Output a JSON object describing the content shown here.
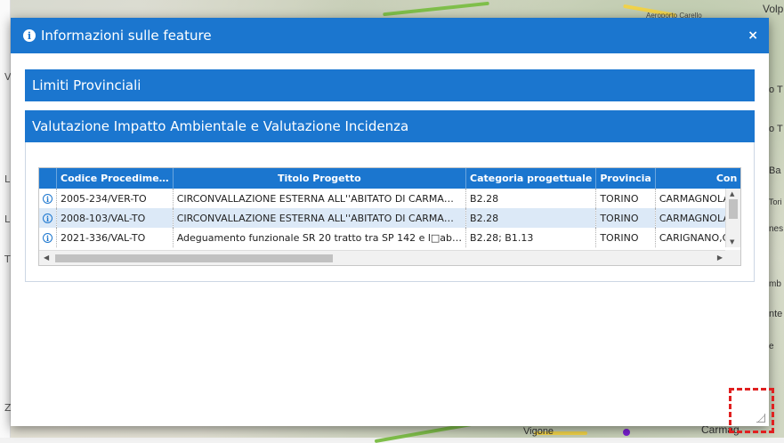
{
  "dialog": {
    "title": "Informazioni sulle feature",
    "close_label": "×"
  },
  "sections": [
    {
      "title": "Limiti Provinciali"
    },
    {
      "title": "Valutazione Impatto Ambientale e Valutazione Incidenza"
    }
  ],
  "table": {
    "columns": [
      "",
      "Codice Procedime…",
      "Titolo Progetto",
      "Categoria progettuale",
      "Provincia",
      "Con"
    ],
    "rows": [
      {
        "icon": "info-icon",
        "codice": "2005-234/VER-TO",
        "titolo": "CIRCONVALLAZIONE ESTERNA ALL''ABITATO DI CARMA…",
        "categoria": "B2.28",
        "provincia": "TORINO",
        "comune": "CARMAGNOLA"
      },
      {
        "icon": "info-icon",
        "codice": "2008-103/VAL-TO",
        "titolo": "CIRCONVALLAZIONE ESTERNA ALL''ABITATO DI CARMA…",
        "categoria": "B2.28",
        "provincia": "TORINO",
        "comune": "CARMAGNOLA"
      },
      {
        "icon": "info-icon",
        "codice": "2021-336/VAL-TO",
        "titolo": "Adeguamento funzionale SR 20 tratto tra SP 142 e l□ab…",
        "categoria": "B2.28; B1.13",
        "provincia": "TORINO",
        "comune": "CARIGNANO,C"
      }
    ]
  },
  "map": {
    "labels": [
      "Volp",
      "Aeroporto Carello",
      "Vigone",
      "Carmag"
    ],
    "side_letters": [
      "V",
      "L",
      "L",
      "T",
      "Z"
    ],
    "right_labels": [
      "o T",
      "o T",
      "Ba",
      "Tori",
      "nes",
      "mb",
      "nte",
      "e"
    ]
  },
  "colors": {
    "primary": "#1b76cf",
    "alt_row": "#dce9f7"
  }
}
